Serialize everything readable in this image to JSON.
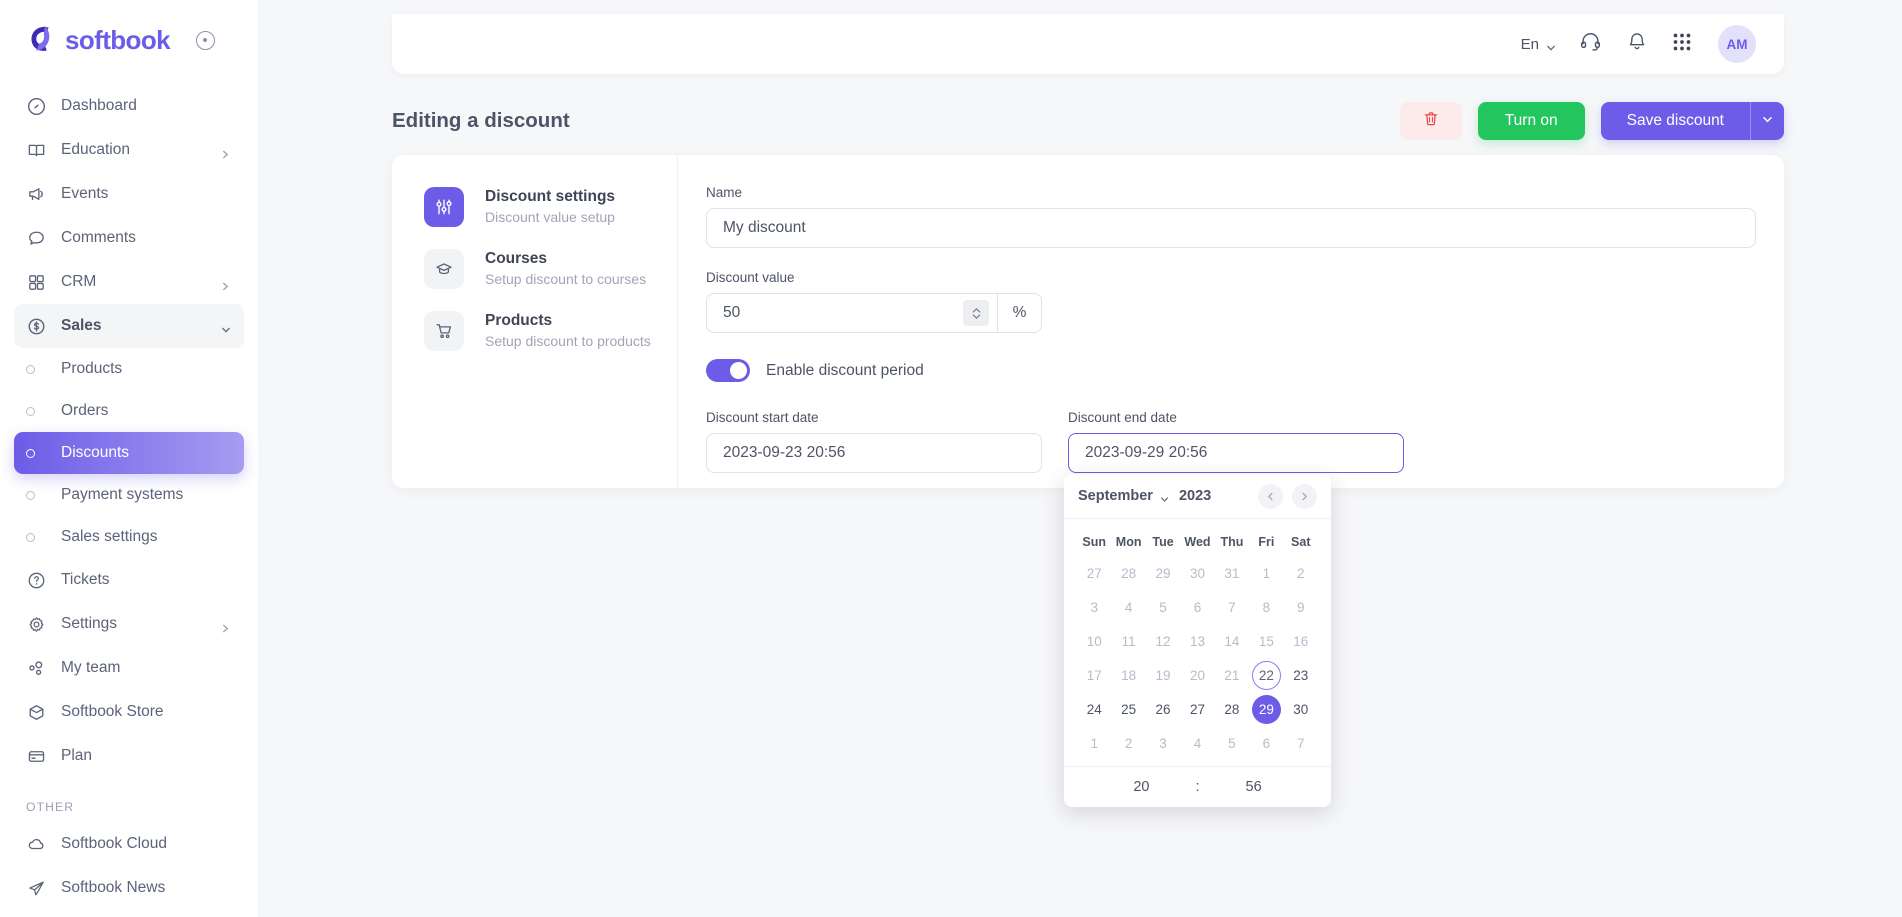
{
  "brand": {
    "name": "softbook",
    "accent": "#6c5ce7"
  },
  "sidebar": {
    "collapse_icon": "collapse-circle-icon",
    "items": [
      {
        "label": "Dashboard",
        "icon": "dashboard-icon",
        "chevron": false
      },
      {
        "label": "Education",
        "icon": "book-icon",
        "chevron": true
      },
      {
        "label": "Events",
        "icon": "megaphone-icon",
        "chevron": false
      },
      {
        "label": "Comments",
        "icon": "comment-icon",
        "chevron": false
      },
      {
        "label": "CRM",
        "icon": "grid-icon",
        "chevron": true
      },
      {
        "label": "Sales",
        "icon": "dollar-circle-icon",
        "chevron": true,
        "expanded": true
      }
    ],
    "sales_children": [
      {
        "label": "Products",
        "active": false
      },
      {
        "label": "Orders",
        "active": false
      },
      {
        "label": "Discounts",
        "active": true
      },
      {
        "label": "Payment systems",
        "active": false
      },
      {
        "label": "Sales settings",
        "active": false
      }
    ],
    "items_after": [
      {
        "label": "Tickets",
        "icon": "question-circle-icon",
        "chevron": false
      },
      {
        "label": "Settings",
        "icon": "gear-icon",
        "chevron": true
      },
      {
        "label": "My team",
        "icon": "team-icon",
        "chevron": false
      },
      {
        "label": "Softbook Store",
        "icon": "box-icon",
        "chevron": false
      },
      {
        "label": "Plan",
        "icon": "card-icon",
        "chevron": false
      }
    ],
    "other_section_label": "OTHER",
    "other_items": [
      {
        "label": "Softbook Cloud",
        "icon": "cloud-icon"
      },
      {
        "label": "Softbook News",
        "icon": "paper-plane-icon"
      }
    ]
  },
  "header": {
    "language": "En",
    "icons": [
      "headset-icon",
      "bell-icon",
      "apps-grid-icon"
    ],
    "avatar_initials": "AM"
  },
  "page": {
    "title": "Editing a discount",
    "delete_label": "delete",
    "turn_on_label": "Turn on",
    "save_label": "Save discount"
  },
  "settings_nav": [
    {
      "title": "Discount settings",
      "subtitle": "Discount value setup",
      "icon": "sliders-icon",
      "active": true
    },
    {
      "title": "Courses",
      "subtitle": "Setup discount to courses",
      "icon": "graduation-cap-icon",
      "active": false
    },
    {
      "title": "Products",
      "subtitle": "Setup discount to products",
      "icon": "cart-icon",
      "active": false
    }
  ],
  "form": {
    "name_label": "Name",
    "name_value": "My discount",
    "value_label": "Discount value",
    "value_value": "50",
    "value_suffix": "%",
    "toggle_label": "Enable discount period",
    "toggle_on": true,
    "start_label": "Discount start date",
    "start_value": "2023-09-23 20:56",
    "end_label": "Discount end date",
    "end_value": "2023-09-29 20:56"
  },
  "datepicker": {
    "month": "September",
    "year": "2023",
    "dow": [
      "Sun",
      "Mon",
      "Tue",
      "Wed",
      "Thu",
      "Fri",
      "Sat"
    ],
    "weeks": [
      [
        {
          "d": "27",
          "state": "muted"
        },
        {
          "d": "28",
          "state": "muted"
        },
        {
          "d": "29",
          "state": "muted"
        },
        {
          "d": "30",
          "state": "muted"
        },
        {
          "d": "31",
          "state": "muted"
        },
        {
          "d": "1",
          "state": "muted"
        },
        {
          "d": "2",
          "state": "muted"
        }
      ],
      [
        {
          "d": "3",
          "state": "muted"
        },
        {
          "d": "4",
          "state": "muted"
        },
        {
          "d": "5",
          "state": "muted"
        },
        {
          "d": "6",
          "state": "muted"
        },
        {
          "d": "7",
          "state": "muted"
        },
        {
          "d": "8",
          "state": "muted"
        },
        {
          "d": "9",
          "state": "muted"
        }
      ],
      [
        {
          "d": "10",
          "state": "muted"
        },
        {
          "d": "11",
          "state": "muted"
        },
        {
          "d": "12",
          "state": "muted"
        },
        {
          "d": "13",
          "state": "muted"
        },
        {
          "d": "14",
          "state": "muted"
        },
        {
          "d": "15",
          "state": "muted"
        },
        {
          "d": "16",
          "state": "muted"
        }
      ],
      [
        {
          "d": "17",
          "state": "muted"
        },
        {
          "d": "18",
          "state": "muted"
        },
        {
          "d": "19",
          "state": "muted"
        },
        {
          "d": "20",
          "state": "muted"
        },
        {
          "d": "21",
          "state": "muted"
        },
        {
          "d": "22",
          "state": "today"
        },
        {
          "d": "23",
          "state": "normal"
        }
      ],
      [
        {
          "d": "24",
          "state": "normal"
        },
        {
          "d": "25",
          "state": "normal"
        },
        {
          "d": "26",
          "state": "normal"
        },
        {
          "d": "27",
          "state": "normal"
        },
        {
          "d": "28",
          "state": "normal"
        },
        {
          "d": "29",
          "state": "selected"
        },
        {
          "d": "30",
          "state": "normal"
        }
      ],
      [
        {
          "d": "1",
          "state": "muted"
        },
        {
          "d": "2",
          "state": "muted"
        },
        {
          "d": "3",
          "state": "muted"
        },
        {
          "d": "4",
          "state": "muted"
        },
        {
          "d": "5",
          "state": "muted"
        },
        {
          "d": "6",
          "state": "muted"
        },
        {
          "d": "7",
          "state": "muted"
        }
      ]
    ],
    "hour": "20",
    "separator": ":",
    "minute": "56",
    "prev_icon": "chevron-left-icon",
    "next_icon": "chevron-right-icon"
  }
}
